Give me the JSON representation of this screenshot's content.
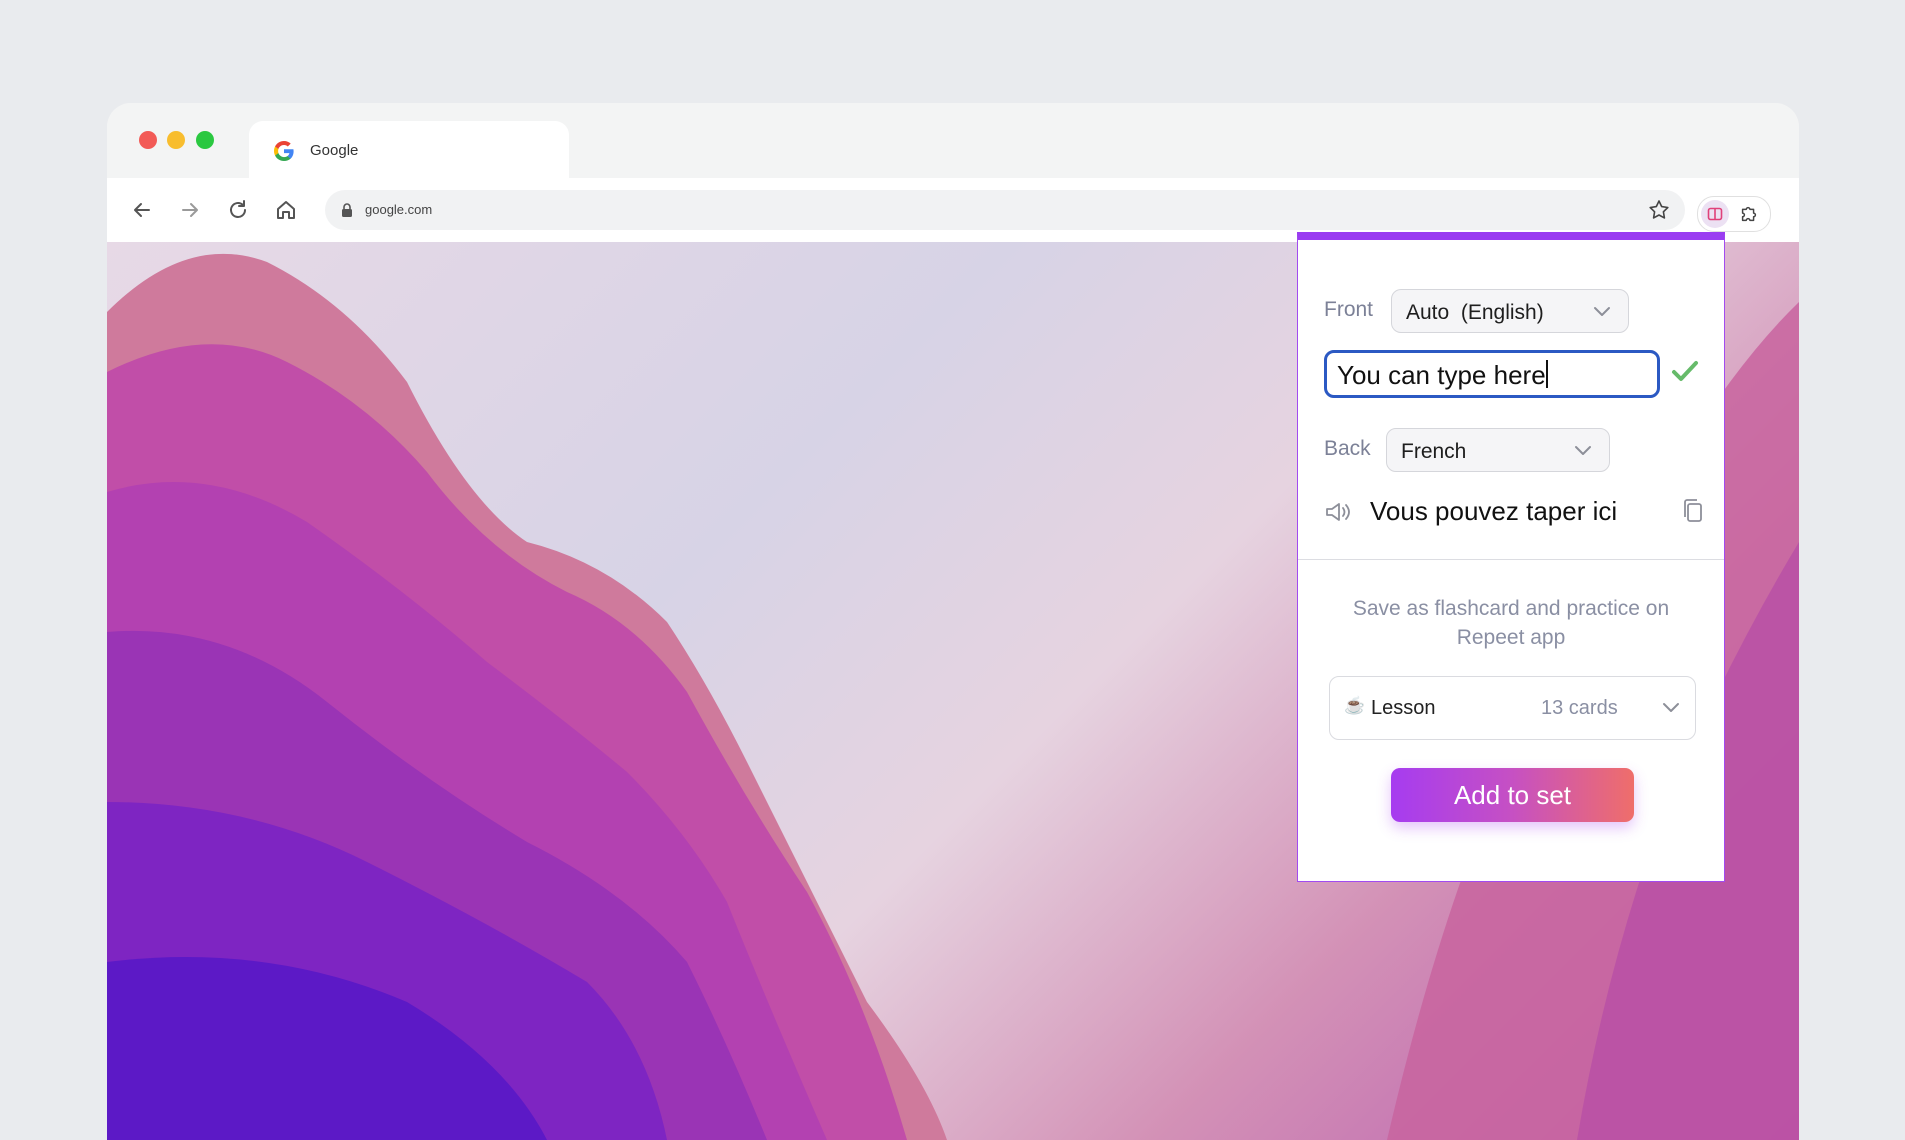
{
  "browser": {
    "tab": {
      "title": "Google",
      "favicon": "google-icon"
    },
    "address": {
      "url": "google.com",
      "lock_icon": "lock-icon",
      "bookmark_icon": "star-icon"
    },
    "nav_icons": [
      "back-arrow-icon",
      "forward-arrow-icon",
      "reload-icon",
      "home-icon"
    ],
    "extensions": [
      "repeet-extension-icon",
      "puzzle-icon"
    ]
  },
  "popup": {
    "accent": "#9a3df1",
    "front": {
      "label": "Front",
      "language": "Auto  (English)"
    },
    "input": {
      "value": "You can type here"
    },
    "back": {
      "label": "Back",
      "language": "French"
    },
    "translation": "Vous pouvez taper ici",
    "save_prompt": "Save as flashcard and practice on Repeet app",
    "set": {
      "emoji": "☕",
      "name": "Lesson",
      "count": "13 cards"
    },
    "add_button": "Add to set",
    "button_gradient": [
      "#a63cf0",
      "#ef6e6a"
    ]
  }
}
